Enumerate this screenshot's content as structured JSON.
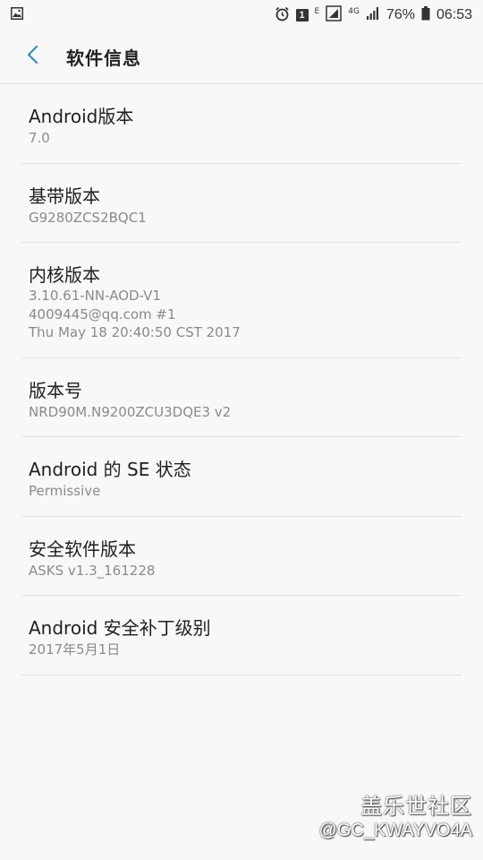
{
  "status_bar": {
    "notification_badge": "1",
    "network_e": "E",
    "network_4g": "4G",
    "battery": "76%",
    "time": "06:53"
  },
  "header": {
    "title": "软件信息"
  },
  "items": [
    {
      "title": "Android版本",
      "value": "7.0"
    },
    {
      "title": "基带版本",
      "value": "G9280ZCS2BQC1"
    },
    {
      "title": "内核版本",
      "value": "3.10.61-NN-AOD-V1\n4009445@qq.com #1\nThu May 18 20:40:50 CST 2017"
    },
    {
      "title": "版本号",
      "value": "NRD90M.N9200ZCU3DQE3 v2"
    },
    {
      "title": "Android 的 SE 状态",
      "value": "Permissive"
    },
    {
      "title": "安全软件版本",
      "value": "ASKS v1.3_161228"
    },
    {
      "title": "Android 安全补丁级别",
      "value": "2017年5月1日"
    }
  ],
  "watermark": {
    "site": "盖乐世社区",
    "user": "@GC_KWAYVO4A"
  },
  "icons": {
    "status_left": "image-notification-icon",
    "alarm": "alarm-icon",
    "sim": "sim-icon",
    "signal": "signal-icon",
    "battery": "battery-icon",
    "back": "back-arrow-icon"
  },
  "colors": {
    "accent": "#3a8cbd",
    "background": "#f8f8f8",
    "secondary_text": "#8a8a8a"
  }
}
